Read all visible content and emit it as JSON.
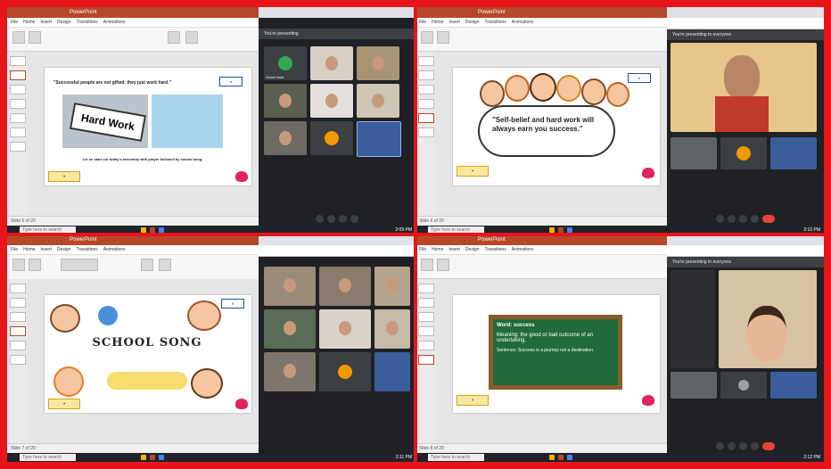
{
  "quadrants": [
    {
      "ppt_title": "PowerPoint",
      "tabs": [
        "File",
        "Home",
        "Insert",
        "Design",
        "Transitions",
        "Animations",
        "Slide Show",
        "Review",
        "View"
      ],
      "slide_quote": "\"Successful people are not gifted; they just work hard.\"",
      "slide_caption": "Let us start our today's assembly with prayer followed by school song.",
      "sign_text": "Hard Work",
      "status": "Slide 5 of 20",
      "search": "Type here to search",
      "clock": "2:09 PM",
      "meet_banner": "You're presenting",
      "tiles": [
        "Guest Host",
        "",
        "",
        "",
        "",
        "",
        "",
        "",
        ""
      ]
    },
    {
      "ppt_title": "PowerPoint",
      "tabs": [
        "File",
        "Home",
        "Insert",
        "Design",
        "Transitions",
        "Animations",
        "Slide Show",
        "Review",
        "View"
      ],
      "slide_quote": "\"Self-belief and hard work will always earn you success.\"",
      "status": "Slide 6 of 20",
      "search": "Type here to search",
      "clock": "2:10 PM",
      "meet_banner": "You're presenting to everyone",
      "tiles": [
        "",
        "",
        "",
        ""
      ]
    },
    {
      "ppt_title": "PowerPoint",
      "tabs": [
        "File",
        "Home",
        "Insert",
        "Design",
        "Transitions",
        "Animations",
        "Slide Show",
        "Review",
        "View"
      ],
      "slide_quote": "SCHOOL SONG",
      "status": "Slide 7 of 20",
      "search": "Type here to search",
      "clock": "2:11 PM",
      "meet_banner": "",
      "tiles": [
        "",
        "",
        "",
        "",
        "",
        "",
        "",
        "",
        ""
      ]
    },
    {
      "ppt_title": "PowerPoint",
      "tabs": [
        "File",
        "Home",
        "Insert",
        "Design",
        "Transitions",
        "Animations",
        "Slide Show",
        "Review",
        "View"
      ],
      "chalk_title": "Word: success",
      "chalk_meaning": "Meaning: the good or bad outcome of an undertaking.",
      "chalk_sentence": "Sentence: Success is a journey not a destination.",
      "status": "Slide 8 of 20",
      "search": "Type here to search",
      "clock": "2:12 PM",
      "meet_banner": "You're presenting to everyone",
      "tiles": [
        "",
        "",
        ""
      ]
    }
  ],
  "colors": {
    "border": "#e8141b",
    "ppt": "#b7472a",
    "meet_bg": "#202124",
    "chalk": "#1f6b3a"
  },
  "icons": [
    "hand-raise-icon",
    "mic-icon",
    "camera-icon",
    "present-icon",
    "end-call-icon"
  ]
}
